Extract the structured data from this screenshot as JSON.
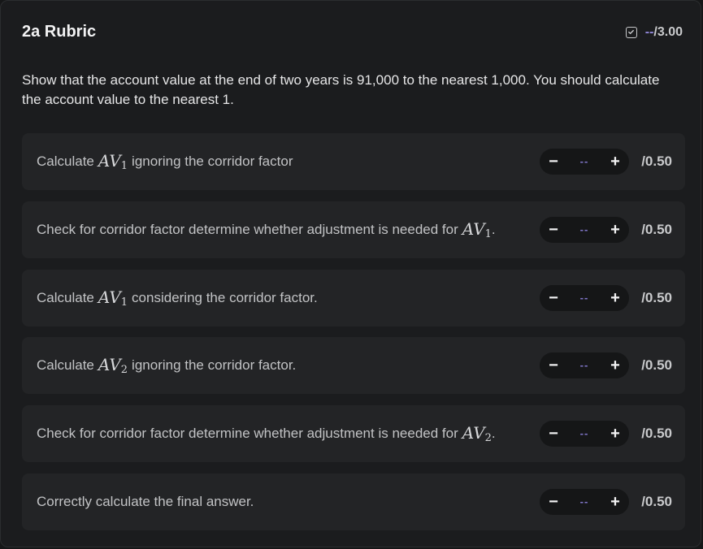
{
  "rubric": {
    "title": "2a Rubric",
    "score": {
      "current": "--",
      "total": "/3.00"
    },
    "description": "Show that the account value at the end of two years is 91,000 to the nearest 1,000. You should calculate the account value to the nearest 1.",
    "colors": {
      "accent": "#9087d9",
      "panel": "#1b1c1e",
      "row": "#232426"
    },
    "icons": {
      "score": "checkbox-icon",
      "decrease": "minus",
      "increase": "plus"
    },
    "items": [
      {
        "before": "Calculate",
        "math_base": "AV",
        "math_sub": "1",
        "after": "ignoring the corridor factor",
        "value": "--",
        "max": "/0.50"
      },
      {
        "before": "Check for corridor factor determine whether adjustment is needed for",
        "math_base": "AV",
        "math_sub": "1",
        "after": ".",
        "value": "--",
        "max": "/0.50"
      },
      {
        "before": "Calculate",
        "math_base": "AV",
        "math_sub": "1",
        "after": "considering the corridor factor.",
        "value": "--",
        "max": "/0.50"
      },
      {
        "before": "Calculate",
        "math_base": "AV",
        "math_sub": "2",
        "after": "ignoring the corridor factor.",
        "value": "--",
        "max": "/0.50"
      },
      {
        "before": "Check for corridor factor determine whether adjustment is needed for",
        "math_base": "AV",
        "math_sub": "2",
        "after": ".",
        "value": "--",
        "max": "/0.50"
      },
      {
        "before": "Correctly calculate the final answer.",
        "math_base": "",
        "math_sub": "",
        "after": "",
        "value": "--",
        "max": "/0.50"
      }
    ],
    "stepper": {
      "minus_label": "−",
      "plus_label": "+"
    }
  }
}
